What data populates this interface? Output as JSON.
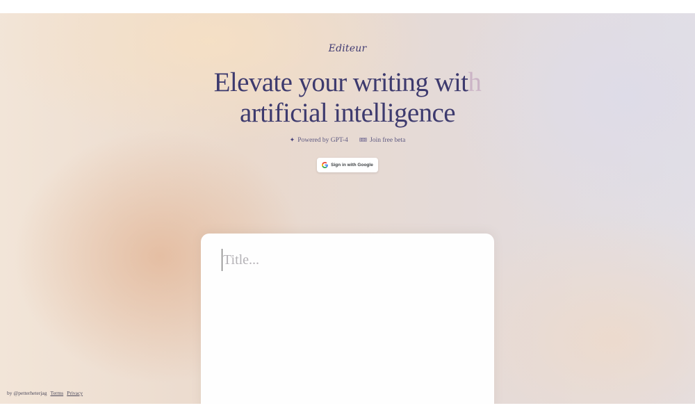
{
  "brand": {
    "logo_text": "Editeur"
  },
  "hero": {
    "headline_line1_main": "Elevate your writing wit",
    "headline_line1_fade": "h",
    "headline_line2": "artificial intelligence"
  },
  "badges": [
    {
      "icon": "sparkle-icon",
      "label": "Powered by GPT-4"
    },
    {
      "icon": "ticket-icon",
      "label": "Join free beta"
    }
  ],
  "auth": {
    "signin_label": "Sign in with Google"
  },
  "editor": {
    "title_placeholder": "Title..."
  },
  "footer": {
    "by_label": "by @petterheterjag",
    "terms_label": "Terms",
    "privacy_label": "Privacy"
  },
  "colors": {
    "brand_text": "#3d3a6e",
    "placeholder": "#b4b2b6",
    "editor_bg": "#fefefe"
  }
}
